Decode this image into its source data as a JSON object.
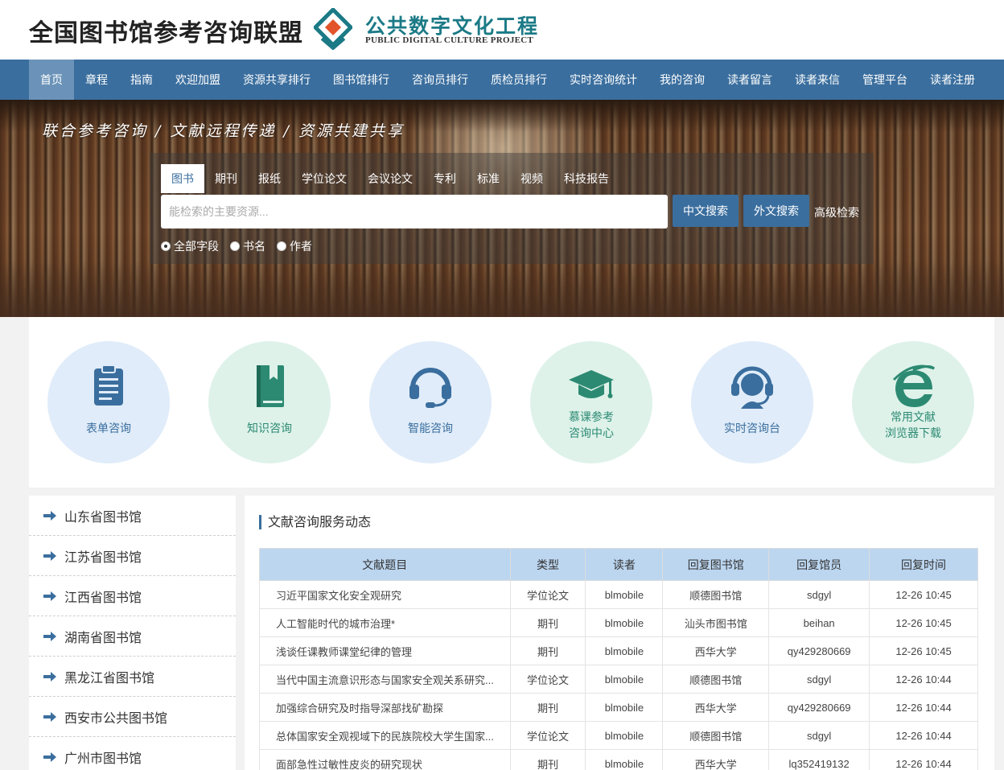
{
  "header": {
    "site_title": "全国图书馆参考咨询联盟",
    "logo_cn": "公共数字文化工程",
    "logo_en": "PUBLIC DIGITAL CULTURE PROJECT"
  },
  "nav": [
    "首页",
    "章程",
    "指南",
    "欢迎加盟",
    "资源共享排行",
    "图书馆排行",
    "咨询员排行",
    "质检员排行",
    "实时咨询统计",
    "我的咨询",
    "读者留言",
    "读者来信",
    "管理平台",
    "读者注册"
  ],
  "banner": {
    "slogan": "联合参考咨询 / 文献远程传递 / 资源共建共享"
  },
  "search": {
    "tabs": [
      "图书",
      "期刊",
      "报纸",
      "学位论文",
      "会议论文",
      "专利",
      "标准",
      "视频",
      "科技报告"
    ],
    "placeholder": "能检索的主要资源...",
    "btn_cn": "中文搜索",
    "btn_foreign": "外文搜索",
    "advanced": "高级检索",
    "radios": [
      "全部字段",
      "书名",
      "作者"
    ],
    "selected_radio": "全部字段"
  },
  "services": [
    {
      "label1": "表单咨询",
      "label2": "",
      "icon": "clipboard-icon",
      "color": "blue"
    },
    {
      "label1": "知识咨询",
      "label2": "",
      "icon": "book-icon",
      "color": "green"
    },
    {
      "label1": "智能咨询",
      "label2": "",
      "icon": "headset-icon",
      "color": "blue"
    },
    {
      "label1": "慕课参考",
      "label2": "咨询中心",
      "icon": "graduation-cap-icon",
      "color": "green"
    },
    {
      "label1": "实时咨询台",
      "label2": "",
      "icon": "agent-headset-icon",
      "color": "blue"
    },
    {
      "label1": "常用文献",
      "label2": "浏览器下载",
      "icon": "ie-browser-icon",
      "color": "green"
    }
  ],
  "libraries": [
    "山东省图书馆",
    "江苏省图书馆",
    "江西省图书馆",
    "湖南省图书馆",
    "黑龙江省图书馆",
    "西安市公共图书馆",
    "广州市图书馆"
  ],
  "news": {
    "title": "文献咨询服务动态",
    "columns": [
      "文献题目",
      "类型",
      "读者",
      "回复图书馆",
      "回复馆员",
      "回复时间"
    ],
    "rows": [
      [
        "习近平国家文化安全观研究",
        "学位论文",
        "blmobile",
        "顺德图书馆",
        "sdgyl",
        "12-26 10:45"
      ],
      [
        "人工智能时代的城市治理*",
        "期刊",
        "blmobile",
        "汕头市图书馆",
        "beihan",
        "12-26 10:45"
      ],
      [
        "浅谈任课教师课堂纪律的管理",
        "期刊",
        "blmobile",
        "西华大学",
        "qy429280669",
        "12-26 10:45"
      ],
      [
        "当代中国主流意识形态与国家安全观关系研究...",
        "学位论文",
        "blmobile",
        "顺德图书馆",
        "sdgyl",
        "12-26 10:44"
      ],
      [
        "加强综合研究及时指导深部找矿勘探",
        "期刊",
        "blmobile",
        "西华大学",
        "qy429280669",
        "12-26 10:44"
      ],
      [
        "总体国家安全观视域下的民族院校大学生国家...",
        "学位论文",
        "blmobile",
        "顺德图书馆",
        "sdgyl",
        "12-26 10:44"
      ],
      [
        "面部急性过敏性皮炎的研究现状",
        "期刊",
        "blmobile",
        "西华大学",
        "lq352419132",
        "12-26 10:44"
      ]
    ]
  },
  "colors": {
    "nav_bg": "#3a6e9e",
    "nav_active": "#6b93b9",
    "accent_blue": "#3a6e9e",
    "accent_green": "#2c8a72",
    "table_header": "#bcd6f0"
  }
}
